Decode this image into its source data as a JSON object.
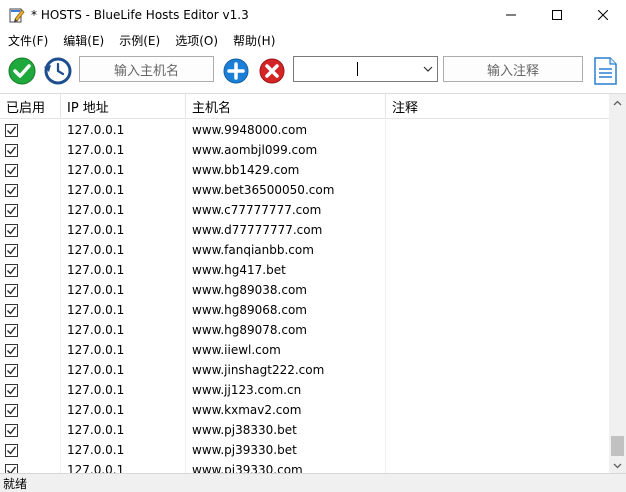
{
  "window": {
    "title": "* HOSTS - BlueLife Hosts Editor v1.3"
  },
  "menu": [
    "文件(F)",
    "编辑(E)",
    "示例(E)",
    "选项(O)",
    "帮助(H)"
  ],
  "toolbar": {
    "hostname_placeholder": "输入主机名",
    "comment_placeholder": "输入注释",
    "ip_combo_value": ""
  },
  "columns": [
    "已启用",
    "IP 地址",
    "主机名",
    "注释"
  ],
  "rows": [
    {
      "enabled": true,
      "ip": "127.0.0.1",
      "host": "www.9948000.com",
      "comment": ""
    },
    {
      "enabled": true,
      "ip": "127.0.0.1",
      "host": "www.aombjl099.com",
      "comment": ""
    },
    {
      "enabled": true,
      "ip": "127.0.0.1",
      "host": "www.bb1429.com",
      "comment": ""
    },
    {
      "enabled": true,
      "ip": "127.0.0.1",
      "host": "www.bet36500050.com",
      "comment": ""
    },
    {
      "enabled": true,
      "ip": "127.0.0.1",
      "host": "www.c77777777.com",
      "comment": ""
    },
    {
      "enabled": true,
      "ip": "127.0.0.1",
      "host": "www.d77777777.com",
      "comment": ""
    },
    {
      "enabled": true,
      "ip": "127.0.0.1",
      "host": "www.fanqianbb.com",
      "comment": ""
    },
    {
      "enabled": true,
      "ip": "127.0.0.1",
      "host": "www.hg417.bet",
      "comment": ""
    },
    {
      "enabled": true,
      "ip": "127.0.0.1",
      "host": "www.hg89038.com",
      "comment": ""
    },
    {
      "enabled": true,
      "ip": "127.0.0.1",
      "host": "www.hg89068.com",
      "comment": ""
    },
    {
      "enabled": true,
      "ip": "127.0.0.1",
      "host": "www.hg89078.com",
      "comment": ""
    },
    {
      "enabled": true,
      "ip": "127.0.0.1",
      "host": "www.iiewl.com",
      "comment": ""
    },
    {
      "enabled": true,
      "ip": "127.0.0.1",
      "host": "www.jinshagt222.com",
      "comment": ""
    },
    {
      "enabled": true,
      "ip": "127.0.0.1",
      "host": "www.jj123.com.cn",
      "comment": ""
    },
    {
      "enabled": true,
      "ip": "127.0.0.1",
      "host": "www.kxmav2.com",
      "comment": ""
    },
    {
      "enabled": true,
      "ip": "127.0.0.1",
      "host": "www.pj38330.bet",
      "comment": ""
    },
    {
      "enabled": true,
      "ip": "127.0.0.1",
      "host": "www.pj39330.bet",
      "comment": ""
    },
    {
      "enabled": true,
      "ip": "127.0.0.1",
      "host": "www.pj39330.com",
      "comment": ""
    }
  ],
  "status": "就绪",
  "colors": {
    "save_green": "#1fa83b",
    "add_blue": "#1b7fd6",
    "delete_red": "#d42426",
    "selection": "#cce8ff"
  },
  "icons": [
    "app-edit-icon",
    "save-check-icon",
    "restore-clock-icon",
    "add-plus-icon",
    "delete-x-icon",
    "note-document-icon"
  ]
}
